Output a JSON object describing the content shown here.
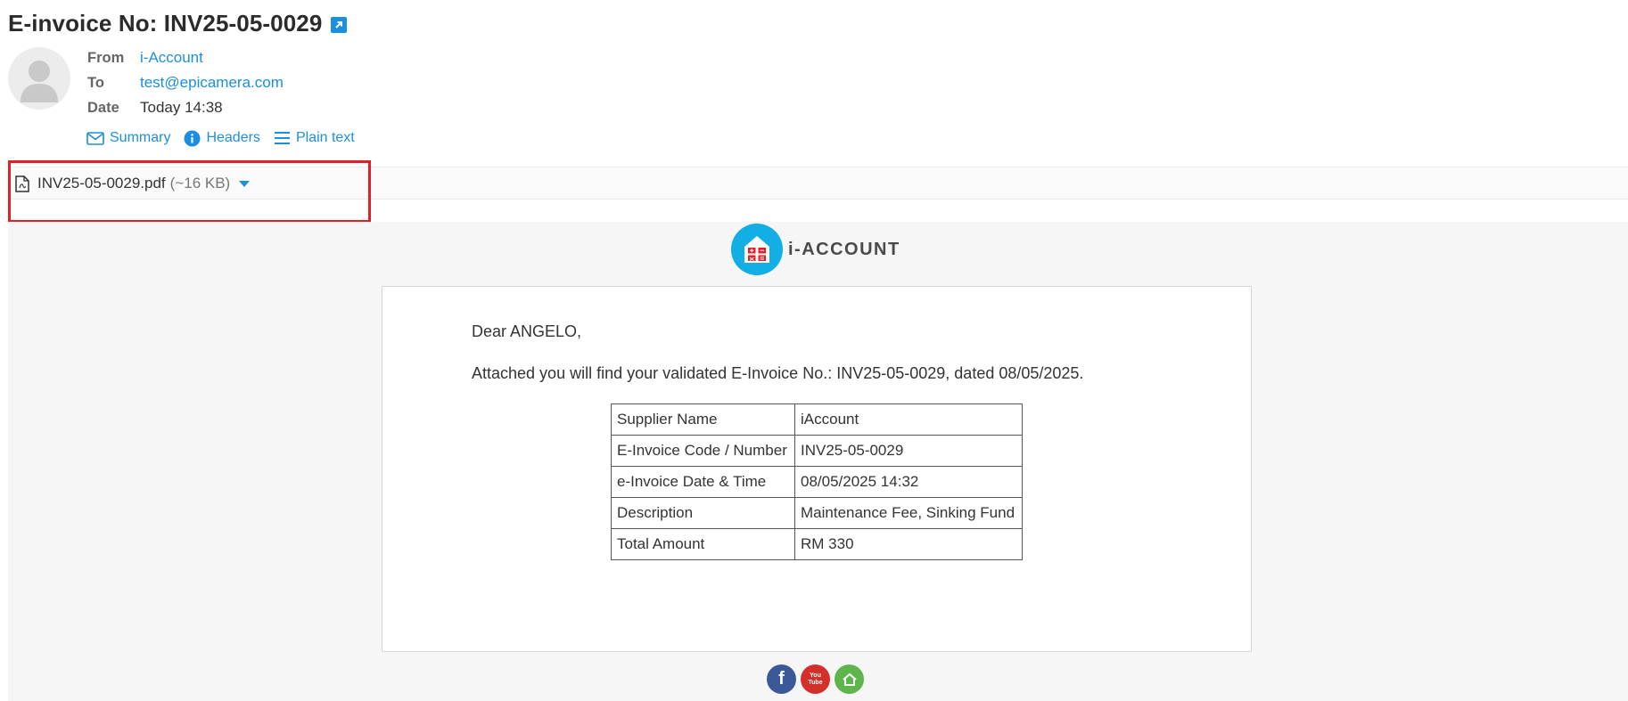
{
  "subject": "E-invoice No: INV25-05-0029",
  "headers": {
    "from_label": "From",
    "from_value": "i-Account",
    "to_label": "To",
    "to_value": "test@epicamera.com",
    "date_label": "Date",
    "date_value": "Today 14:38"
  },
  "views": {
    "summary": "Summary",
    "headers": "Headers",
    "plain_text": "Plain text"
  },
  "attachment": {
    "filename": "INV25-05-0029.pdf",
    "size": "(~16 KB)"
  },
  "brand": {
    "name": "i-ACCOUNT"
  },
  "message": {
    "greeting": "Dear ANGELO,",
    "intro": "Attached you will find your validated E-Invoice No.: INV25-05-0029, dated 08/05/2025."
  },
  "invoice_table": [
    {
      "label": "Supplier Name",
      "value": "iAccount"
    },
    {
      "label": "E-Invoice Code / Number",
      "value": "INV25-05-0029"
    },
    {
      "label": "e-Invoice Date & Time",
      "value": "08/05/2025 14:32"
    },
    {
      "label": "Description",
      "value": "Maintenance Fee, Sinking Fund"
    },
    {
      "label": "Total Amount",
      "value": "RM 330"
    }
  ],
  "social": {
    "facebook_glyph": "f",
    "youtube_glyph": "You",
    "youtube_glyph_2": "Tube"
  },
  "colors": {
    "link": "#1a8fe0",
    "highlight": "#e02228",
    "brand_circle": "#12aee6"
  }
}
